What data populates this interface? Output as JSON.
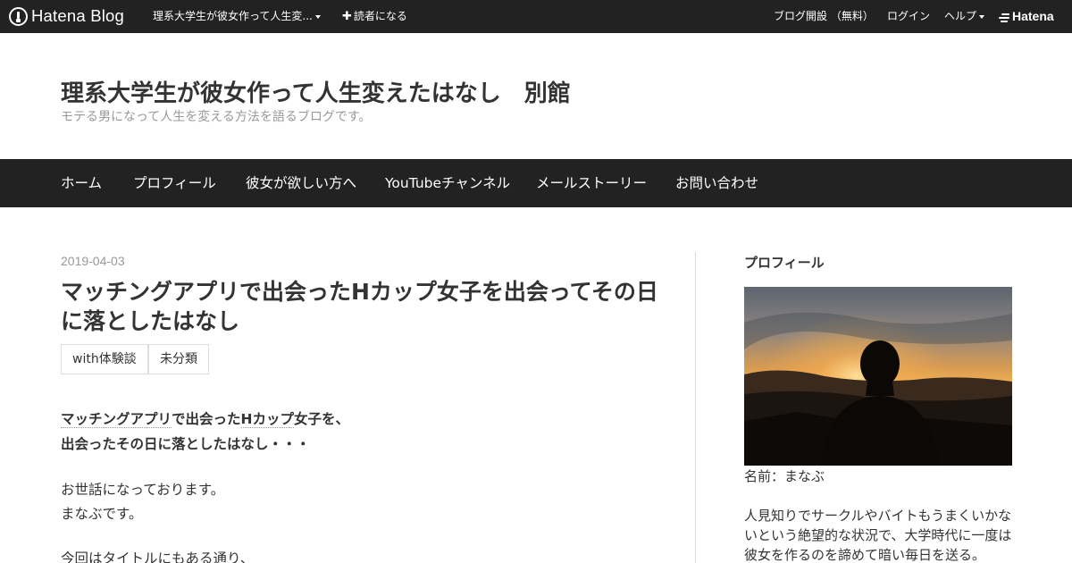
{
  "topbar": {
    "logo_text": "Hatena Blog",
    "blog_menu": "理系大学生が彼女作って人生変...",
    "subscribe": "読者になる",
    "subscribe_plus": "✚",
    "start_blog": "ブログ開設 （無料）",
    "login": "ログイン",
    "help": "ヘルプ",
    "hatena": "Hatena"
  },
  "header": {
    "title": "理系大学生が彼女作って人生変えたはなし　別館",
    "description": "モテる男になって人生を変える方法を語るブログです。"
  },
  "nav": {
    "items": [
      {
        "label": "ホーム"
      },
      {
        "label": "プロフィール"
      },
      {
        "label": "彼女が欲しい方へ"
      },
      {
        "label": "YouTubeチャンネル"
      },
      {
        "label": "メールストーリー"
      },
      {
        "label": "お問い合わせ"
      }
    ]
  },
  "entry": {
    "date": "2019-04-03",
    "title": "マッチングアプリで出会ったHカップ女子を出会ってその日に落としたはなし",
    "categories": [
      "with体験談",
      "未分類"
    ],
    "intro_kw1": "マッチングアプリ",
    "intro_mid": "で出会った",
    "intro_kw2": "Hカップ",
    "intro_end": "女子を、",
    "intro_line2": "出会ったその日に落としたはなし・・・",
    "greeting1": "お世話になっております。",
    "greeting2": "まなぶです。",
    "body1": "今回はタイトルにもある通り、"
  },
  "sidebar": {
    "title": "プロフィール",
    "photo_icon": "silhouette-sunset-photo",
    "name": "名前：まなぶ",
    "bio": [
      "人見知りでサークルやバイトもうまくいかな",
      "いという絶望的な状況で、大学時代に一度は",
      "彼女を作るのを諦めて暗い毎日を送る。"
    ]
  },
  "colors": {
    "bar_bg": "#222222",
    "text": "#333333",
    "muted": "#999999",
    "border": "#dddddd"
  }
}
